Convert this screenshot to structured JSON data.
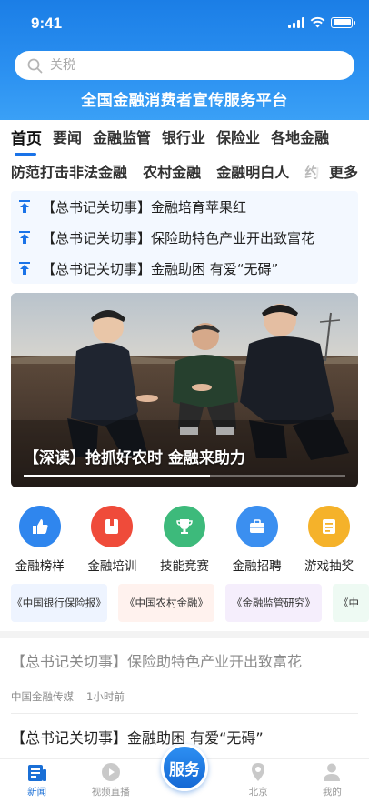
{
  "status_bar": {
    "time": "9:41"
  },
  "search": {
    "placeholder": "关税"
  },
  "header": {
    "platform_title": "全国金融消费者宣传服务平台"
  },
  "tabs_row1": [
    "首页",
    "要闻",
    "金融监管",
    "银行业",
    "保险业",
    "各地金融"
  ],
  "tabs_row2": [
    "防范打击非法金融",
    "农村金融",
    "金融明白人",
    "约"
  ],
  "tabs_more": "更多",
  "headlines": [
    "【总书记关切事】金融培育苹果红",
    "【总书记关切事】保险助特色产业开出致富花",
    "【总书记关切事】金融助困 有爱“无碍”"
  ],
  "banner": {
    "caption": "【深读】抢抓好农时 金融来助力",
    "progress": 0.58
  },
  "quick_actions": [
    {
      "label": "金融榜样",
      "icon": "thumbs-up-icon",
      "color": "#2f86ee"
    },
    {
      "label": "金融培训",
      "icon": "book-icon",
      "color": "#ef4b3a"
    },
    {
      "label": "技能竞赛",
      "icon": "trophy-icon",
      "color": "#3dba7b"
    },
    {
      "label": "金融招聘",
      "icon": "briefcase-icon",
      "color": "#3b8ff0"
    },
    {
      "label": "游戏抽奖",
      "icon": "note-icon",
      "color": "#f5b22a"
    }
  ],
  "journals": [
    {
      "label": "《中国银行保险报》",
      "bg": "#eef4ff"
    },
    {
      "label": "《中国农村金融》",
      "bg": "#fff2ee"
    },
    {
      "label": "《金融监管研究》",
      "bg": "#f5eefc"
    },
    {
      "label": "《中",
      "bg": "#eefaf3"
    }
  ],
  "news": [
    {
      "title": "【总书记关切事】保险助特色产业开出致富花",
      "source": "中国金融传媒",
      "time": "1小时前"
    },
    {
      "title": "【总书记关切事】金融助困 有爱“无碍”"
    }
  ],
  "bottom_nav": {
    "news": "新闻",
    "video": "视频直播",
    "serve": "服务",
    "location": "北京",
    "mine": "我的"
  }
}
